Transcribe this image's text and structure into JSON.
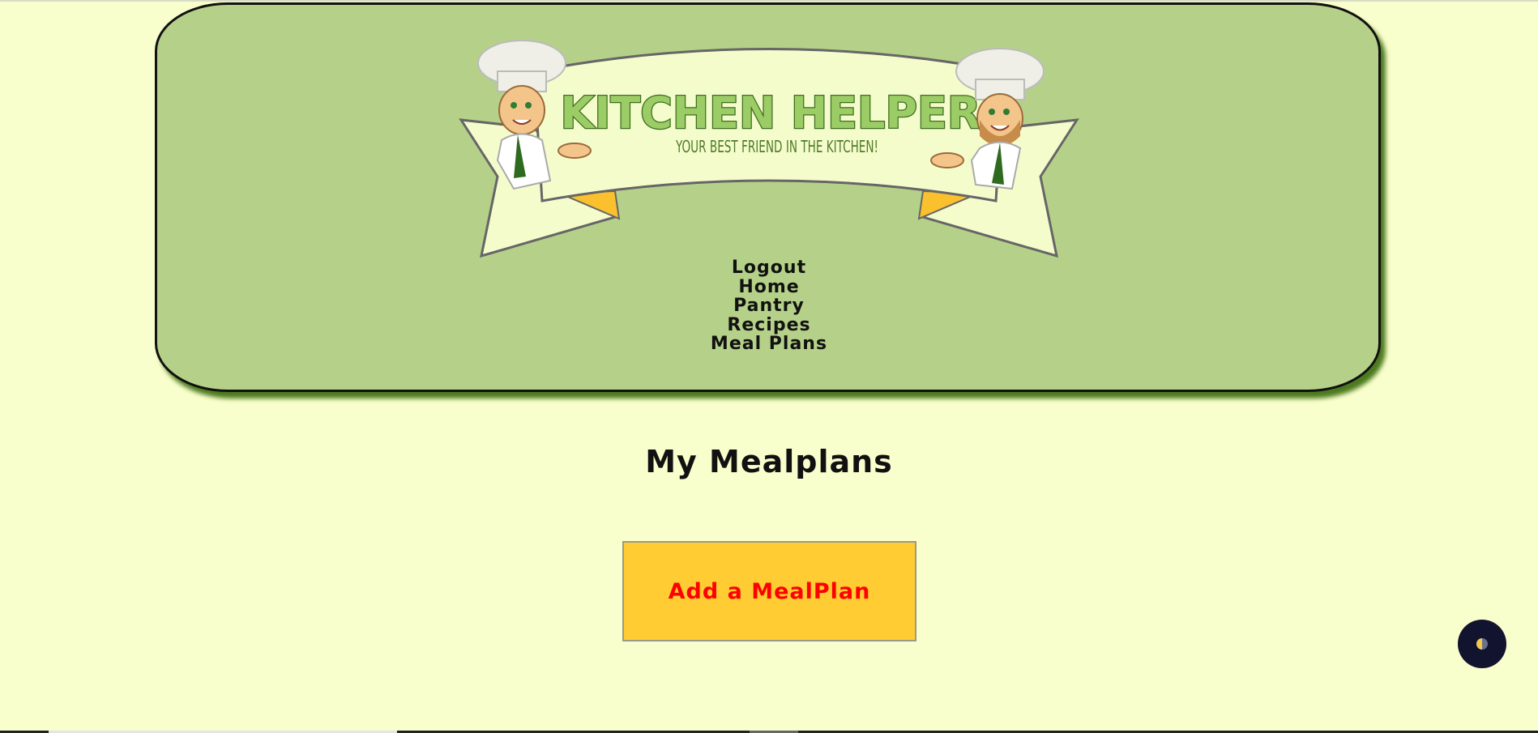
{
  "header": {
    "banner": {
      "title": "KITCHEN HELPER",
      "tagline": "YOUR BEST FRIEND IN THE KITCHEN!"
    },
    "nav": {
      "items": [
        {
          "label": "Logout"
        },
        {
          "label": "Home"
        },
        {
          "label": "Pantry"
        },
        {
          "label": "Recipes"
        },
        {
          "label": "Meal Plans"
        }
      ]
    }
  },
  "main": {
    "title": "My Mealplans",
    "add_button_label": "Add a MealPlan"
  },
  "theme_toggle": {
    "icon": "half-moon-icon"
  },
  "colors": {
    "page_background": "#f9ffcc",
    "header_background": "#b5d189",
    "header_shadow": "#4c7a1f",
    "banner_fill": "#f5fccc",
    "banner_title": "#9ccc65",
    "banner_title_dark": "#3c6e1e",
    "ribbon_tail": "#fbc02d",
    "button_background": "#ffcc33",
    "button_text": "#ff0000",
    "toggle_background": "#12132e"
  }
}
